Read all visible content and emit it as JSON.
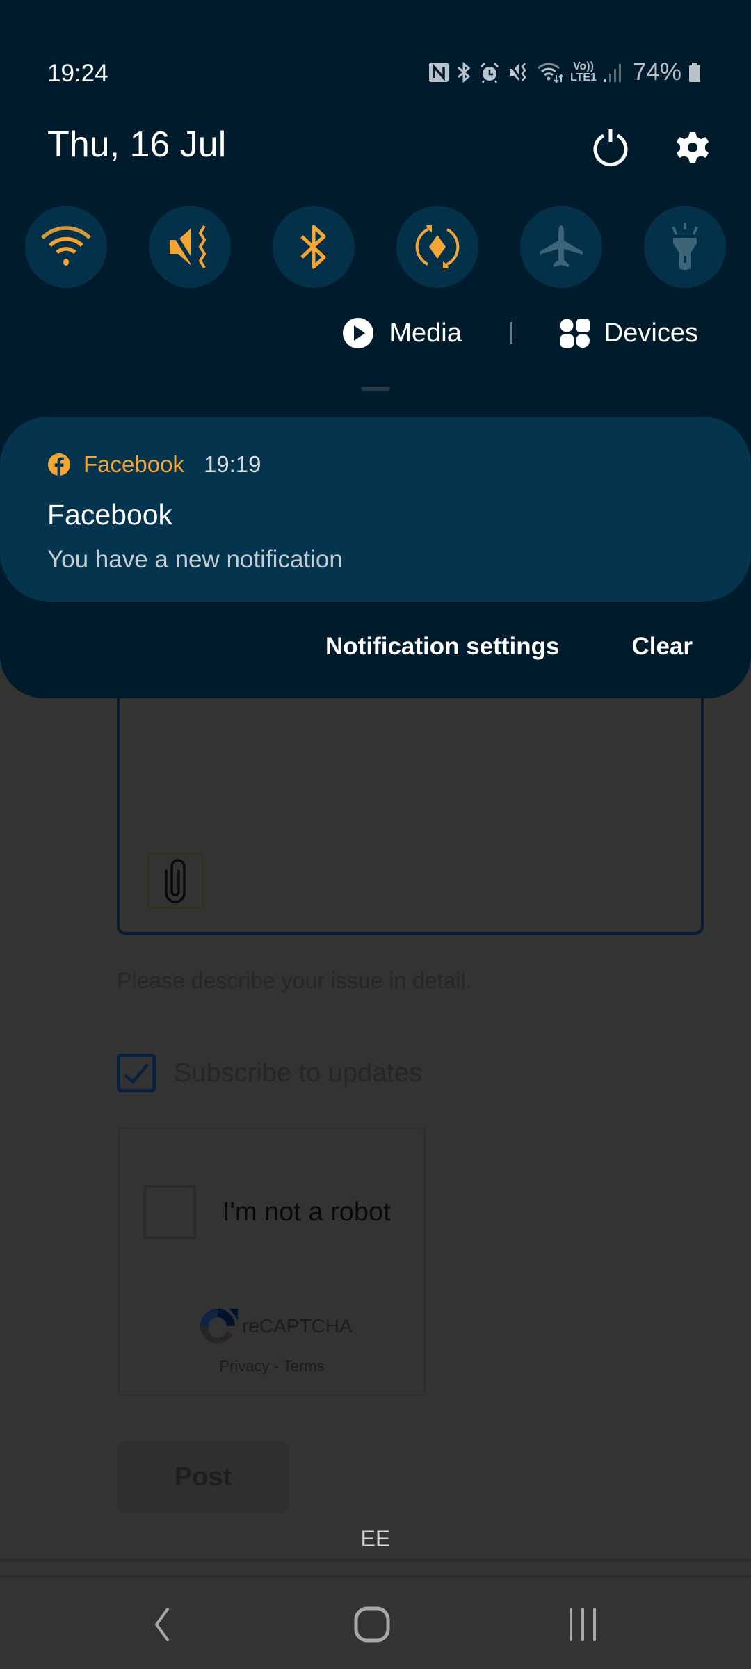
{
  "status_bar": {
    "time": "19:24",
    "icons": [
      "nfc-icon",
      "bluetooth-icon",
      "alarm-icon",
      "vibrate-mute-icon",
      "wifi-icon",
      "volte-lte-icon",
      "signal-icon"
    ],
    "volte_top": "Vo))",
    "volte_bottom": "LTE1",
    "battery_percent": "74%"
  },
  "header": {
    "date": "Thu, 16 Jul",
    "power_icon": "power-icon",
    "settings_icon": "gear-icon"
  },
  "quick_settings": [
    {
      "name": "wifi",
      "icon": "wifi-icon",
      "active": true
    },
    {
      "name": "sound-mute",
      "icon": "vibrate-mute-icon",
      "active": true
    },
    {
      "name": "bluetooth",
      "icon": "bluetooth-icon",
      "active": true
    },
    {
      "name": "auto-rotate",
      "icon": "auto-rotate-icon",
      "active": true
    },
    {
      "name": "airplane-mode",
      "icon": "airplane-icon",
      "active": false
    },
    {
      "name": "flashlight",
      "icon": "flashlight-icon",
      "active": false
    }
  ],
  "media_devices": {
    "media_label": "Media",
    "devices_label": "Devices"
  },
  "notification": {
    "app_name": "Facebook",
    "time": "19:19",
    "title": "Facebook",
    "body": "You have a new notification"
  },
  "shade_actions": {
    "settings_label": "Notification settings",
    "clear_label": "Clear"
  },
  "page": {
    "helper_text": "Please describe your issue in detail.",
    "subscribe_label": "Subscribe to updates",
    "subscribe_checked": true,
    "captcha_label": "I'm not a robot",
    "captcha_brand": "reCAPTCHA",
    "captcha_privacy": "Privacy",
    "captcha_sep": " - ",
    "captcha_terms": "Terms",
    "post_label": "Post",
    "carrier": "EE"
  },
  "colors": {
    "shade_bg": "#001c2c",
    "tile_bg": "#04314a",
    "accent": "#f4a533",
    "inactive_icon": "#3e6478",
    "card_bg": "#04344e"
  }
}
